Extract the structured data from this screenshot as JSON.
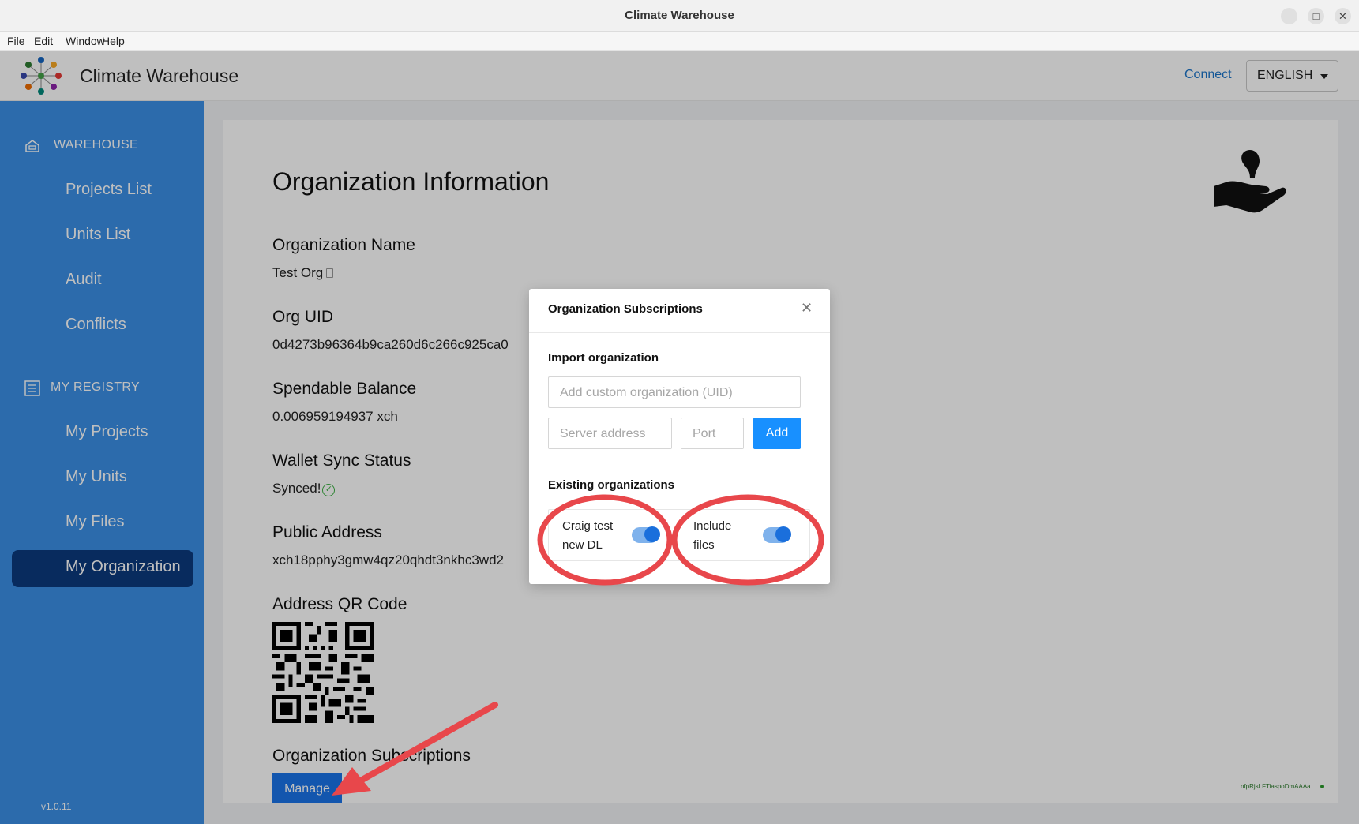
{
  "window": {
    "title": "Climate Warehouse",
    "controls": [
      "minimize-icon",
      "maximize-icon",
      "close-icon"
    ]
  },
  "menubar": [
    "File",
    "Edit",
    "Window",
    "Help"
  ],
  "header": {
    "app_name": "Climate Warehouse",
    "connect_label": "Connect",
    "language": "ENGLISH"
  },
  "sidebar": {
    "warehouse_heading": "WAREHOUSE",
    "warehouse_items": [
      "Projects List",
      "Units List",
      "Audit",
      "Conflicts"
    ],
    "registry_heading": "MY REGISTRY",
    "registry_items": [
      "My Projects",
      "My Units",
      "My Files",
      "My Organization"
    ],
    "active_item": "My Organization",
    "version": "v1.0.11"
  },
  "main": {
    "title": "Organization Information",
    "org_name_label": "Organization Name",
    "org_name_value": "Test Org",
    "org_uid_label": "Org UID",
    "org_uid_value": "0d4273b96364b9ca260d6c266c925ca0",
    "balance_label": "Spendable Balance",
    "balance_value": "0.006959194937 xch",
    "sync_label": "Wallet Sync Status",
    "sync_value": "Synced!",
    "address_label": "Public Address",
    "address_value": "xch18pphy3gmw4qz20qhdt3nkhc3wd2",
    "qr_label": "Address QR Code",
    "subscriptions_label": "Organization Subscriptions",
    "manage_label": "Manage",
    "footer_hash": "nfpRjsLFTiaspoDmAAAa"
  },
  "modal": {
    "title": "Organization Subscriptions",
    "import_heading": "Import organization",
    "uid_placeholder": "Add custom organization (UID)",
    "server_placeholder": "Server address",
    "port_placeholder": "Port",
    "add_label": "Add",
    "existing_heading": "Existing organizations",
    "org_name_line1": "Craig test",
    "org_name_line2": "new DL",
    "include_files_line1": "Include",
    "include_files_line2": "files",
    "subscribed": true,
    "include_files": true
  },
  "colors": {
    "sidebar": "#3b8fe6",
    "sidebar_active": "#0b3a7e",
    "primary": "#1a73e8",
    "annotation": "#e8474b"
  }
}
